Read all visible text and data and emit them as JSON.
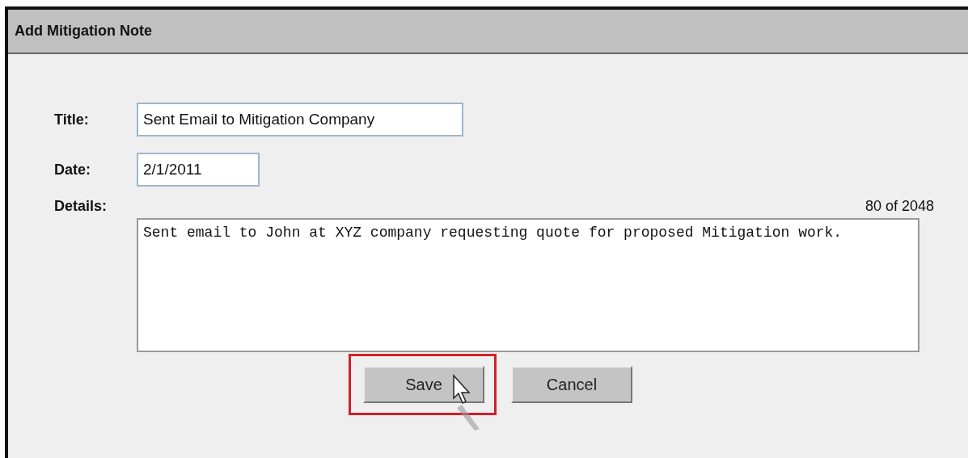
{
  "dialog": {
    "title": "Add Mitigation Note"
  },
  "fields": [
    {
      "label": "Title:",
      "value": "Sent Email to Mitigation Company",
      "kind": "wide"
    },
    {
      "label": "Date:",
      "value": "2/1/2011",
      "kind": "short"
    }
  ],
  "details": {
    "label": "Details:",
    "counter": "80 of 2048",
    "value": "Sent email to John at XYZ company requesting quote for proposed Mitigation work."
  },
  "buttons": [
    {
      "label": "Save",
      "highlighted": true,
      "pointer": true
    },
    {
      "label": "Cancel",
      "highlighted": false,
      "pointer": false
    }
  ]
}
